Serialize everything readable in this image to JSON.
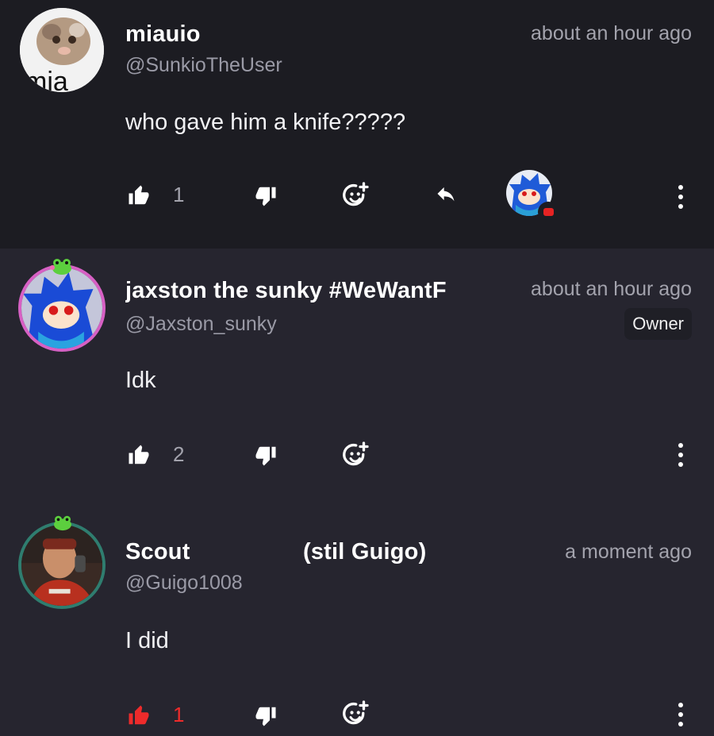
{
  "comments": [
    {
      "name": "miauio",
      "handle": "@SunkioTheUser",
      "time": "about an hour ago",
      "text": "who gave him a knife?????",
      "likes": "1",
      "liked": false,
      "avatar_text": "mia",
      "has_reply_icon": true,
      "has_creator_heart": true
    },
    {
      "name": "jaxston the sunky #WeWantF",
      "handle": "@Jaxston_sunky",
      "time": "about an hour ago",
      "badge": "Owner",
      "text": "Idk",
      "likes": "2",
      "liked": false
    },
    {
      "name_part1": "Scout",
      "name_part2": "(stil Guigo)",
      "handle": "@Guigo1008",
      "time": "a moment ago",
      "text": "I did",
      "likes": "1",
      "liked": true
    }
  ],
  "icons": {
    "like": "thumbs-up-icon",
    "dislike": "thumbs-down-icon",
    "react": "add-reaction-icon",
    "reply": "reply-icon",
    "more": "more-vertical-icon"
  },
  "colors": {
    "background_top": "#1c1c22",
    "background": "#26252f",
    "liked_red": "#ee2b2b",
    "muted_text": "#a3a3ad"
  }
}
